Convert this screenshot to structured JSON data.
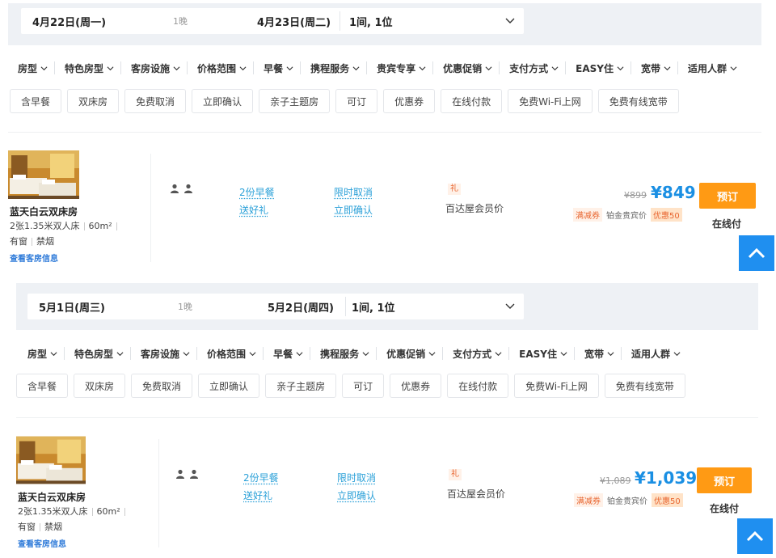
{
  "panels": [
    {
      "checkin": "4月22日(周一)",
      "nights": "1晚",
      "checkout": "4月23日(周二)",
      "guests": "1间, 1位",
      "filters": [
        "房型",
        "特色房型",
        "客房设施",
        "价格范围",
        "早餐",
        "携程服务",
        "贵宾专享",
        "优惠促销",
        "支付方式",
        "EASY住",
        "宽带",
        "适用人群"
      ],
      "tags": [
        "含早餐",
        "双床房",
        "免费取消",
        "立即确认",
        "亲子主题房",
        "可订",
        "优惠券",
        "在线付款",
        "免费Wi-Fi上网",
        "免费有线宽带"
      ],
      "room": {
        "name": "蓝天白云双床房",
        "beds": "2张1.35米双人床",
        "area": "60m²",
        "window": "有窗",
        "smoking": "禁烟",
        "info_link": "查看客房信息",
        "breakfast": "2份早餐",
        "gift": "送好礼",
        "cancel": "限时取消",
        "confirm": "立即确认",
        "gift_tag": "礼",
        "member_price": "百达屋会员价",
        "orig_price": "¥899",
        "price": "¥849",
        "badge_coupon": "满减券",
        "badge_member": "铂金贵宾价",
        "badge_discount": "优惠50",
        "book": "预订",
        "pay": "在线付"
      }
    },
    {
      "checkin": "5月1日(周三)",
      "nights": "1晚",
      "checkout": "5月2日(周四)",
      "guests": "1间, 1位",
      "filters": [
        "房型",
        "特色房型",
        "客房设施",
        "价格范围",
        "早餐",
        "携程服务",
        "优惠促销",
        "支付方式",
        "EASY住",
        "宽带",
        "适用人群"
      ],
      "tags": [
        "含早餐",
        "双床房",
        "免费取消",
        "立即确认",
        "亲子主题房",
        "可订",
        "优惠券",
        "在线付款",
        "免费Wi-Fi上网",
        "免费有线宽带"
      ],
      "room": {
        "name": "蓝天白云双床房",
        "beds": "2张1.35米双人床",
        "area": "60m²",
        "window": "有窗",
        "smoking": "禁烟",
        "info_link": "查看客房信息",
        "breakfast": "2份早餐",
        "gift": "送好礼",
        "cancel": "限时取消",
        "confirm": "立即确认",
        "gift_tag": "礼",
        "member_price": "百达屋会员价",
        "orig_price": "¥1,089",
        "price": "¥1,039",
        "badge_coupon": "满减券",
        "badge_member": "铂金贵宾价",
        "badge_discount": "优惠50",
        "book": "预订",
        "pay": "在线付"
      }
    }
  ],
  "colors": {
    "accent": "#1a8fe3",
    "book": "#ff9a14",
    "link": "#2aa0d8"
  },
  "icons": [
    "chevron-down-icon",
    "person-icon",
    "back-to-top-icon"
  ]
}
